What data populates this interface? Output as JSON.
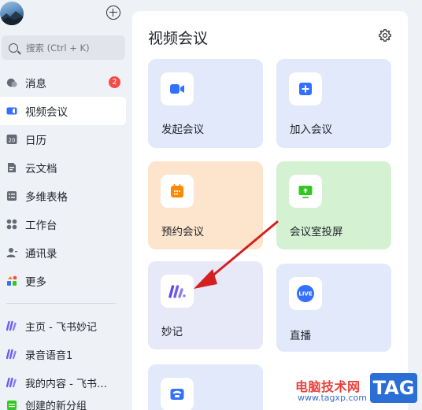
{
  "sidebar": {
    "search_placeholder": "搜索 (Ctrl + K)",
    "messages_badge": "2",
    "nav": [
      {
        "label": "消息",
        "icon": "chat-bubble-icon"
      },
      {
        "label": "视频会议",
        "icon": "video-camera-icon",
        "active": true
      },
      {
        "label": "日历",
        "icon": "calendar-icon"
      },
      {
        "label": "云文档",
        "icon": "cloud-document-icon"
      },
      {
        "label": "多维表格",
        "icon": "table-icon"
      },
      {
        "label": "工作台",
        "icon": "workspace-grid-icon"
      },
      {
        "label": "通讯录",
        "icon": "contacts-icon"
      },
      {
        "label": "更多",
        "icon": "more-apps-icon"
      }
    ],
    "calendar_day": "20",
    "recent": [
      {
        "label": "主页 - 飞书妙记",
        "icon": "minutes-logo-icon"
      },
      {
        "label": "录音语音1",
        "icon": "minutes-logo-icon"
      },
      {
        "label": "我的内容 - 飞书…",
        "icon": "minutes-logo-icon"
      },
      {
        "label": "创建的新分组",
        "icon": "sheet-icon"
      }
    ]
  },
  "main": {
    "title": "视频会议",
    "cards": [
      {
        "label": "发起会议",
        "icon": "video-camera-icon",
        "color": "#e1e9fb",
        "icon_color": "#3370ff"
      },
      {
        "label": "加入会议",
        "icon": "plus-square-icon",
        "color": "#e1e9fb",
        "icon_color": "#3370ff"
      },
      {
        "label": "预约会议",
        "icon": "calendar-schedule-icon",
        "color": "#fde4cc",
        "icon_color": "#ff8800"
      },
      {
        "label": "会议室投屏",
        "icon": "screen-share-icon",
        "color": "#d4f2d1",
        "icon_color": "#34c724"
      },
      {
        "label": "妙记",
        "icon": "minutes-logo-icon",
        "color": "#e7e8f8",
        "icon_color": "#6b5cf0"
      },
      {
        "label": "直播",
        "icon": "live-icon",
        "color": "#e1e9fb",
        "icon_color": "#3370ff",
        "badge": "LIVE"
      },
      {
        "label": "",
        "icon": "phone-icon",
        "color": "#e1e9fb",
        "icon_color": "#3370ff"
      }
    ]
  },
  "watermark": {
    "cn_text": "电脑技术网",
    "url": "www.tagxp.com",
    "tag": "TAG"
  },
  "colors": {
    "accent": "#3370ff",
    "badge_red": "#f54a45",
    "arrow": "#d42020"
  }
}
